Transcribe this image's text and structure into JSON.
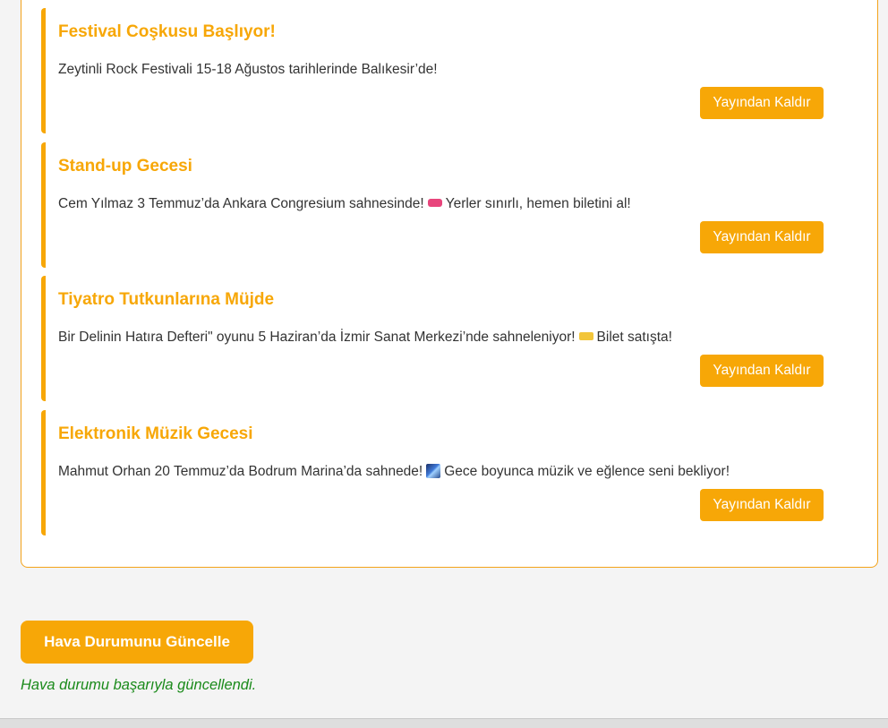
{
  "announcements": [
    {
      "title": "Festival Coşkusu Başlıyor!",
      "text_before": "Zeytinli Rock Festivali 15-18 Ağustos tarihlerinde Balıkesir’de!",
      "emoji": "",
      "text_after": "",
      "button_label": "Yayından Kaldır"
    },
    {
      "title": "Stand-up Gecesi",
      "text_before": "Cem Yılmaz 3 Temmuz’da Ankara Congresium sahnesinde!",
      "emoji": "ticket-pink",
      "text_after": "Yerler sınırlı, hemen biletini al!",
      "button_label": "Yayından Kaldır"
    },
    {
      "title": "Tiyatro Tutkunlarına Müjde",
      "text_before": "Bir Delinin Hatıra Defteri\" oyunu 5 Haziran’da İzmir Sanat Merkezi’nde sahneleniyor!",
      "emoji": "ticket-yellow",
      "text_after": "Bilet satışta!",
      "button_label": "Yayından Kaldır"
    },
    {
      "title": "Elektronik Müzik Gecesi",
      "text_before": "Mahmut Orhan 20 Temmuz’da Bodrum Marina’da sahnede!",
      "emoji": "music-blue",
      "text_after": "Gece boyunca müzik ve eğlence seni bekliyor!",
      "button_label": "Yayından Kaldır"
    }
  ],
  "weather": {
    "button_label": "Hava Durumunu Güncelle",
    "status_message": "Hava durumu başarıyla güncellendi."
  },
  "colors": {
    "accent": "#f7a707",
    "success": "#1a8a1a"
  }
}
